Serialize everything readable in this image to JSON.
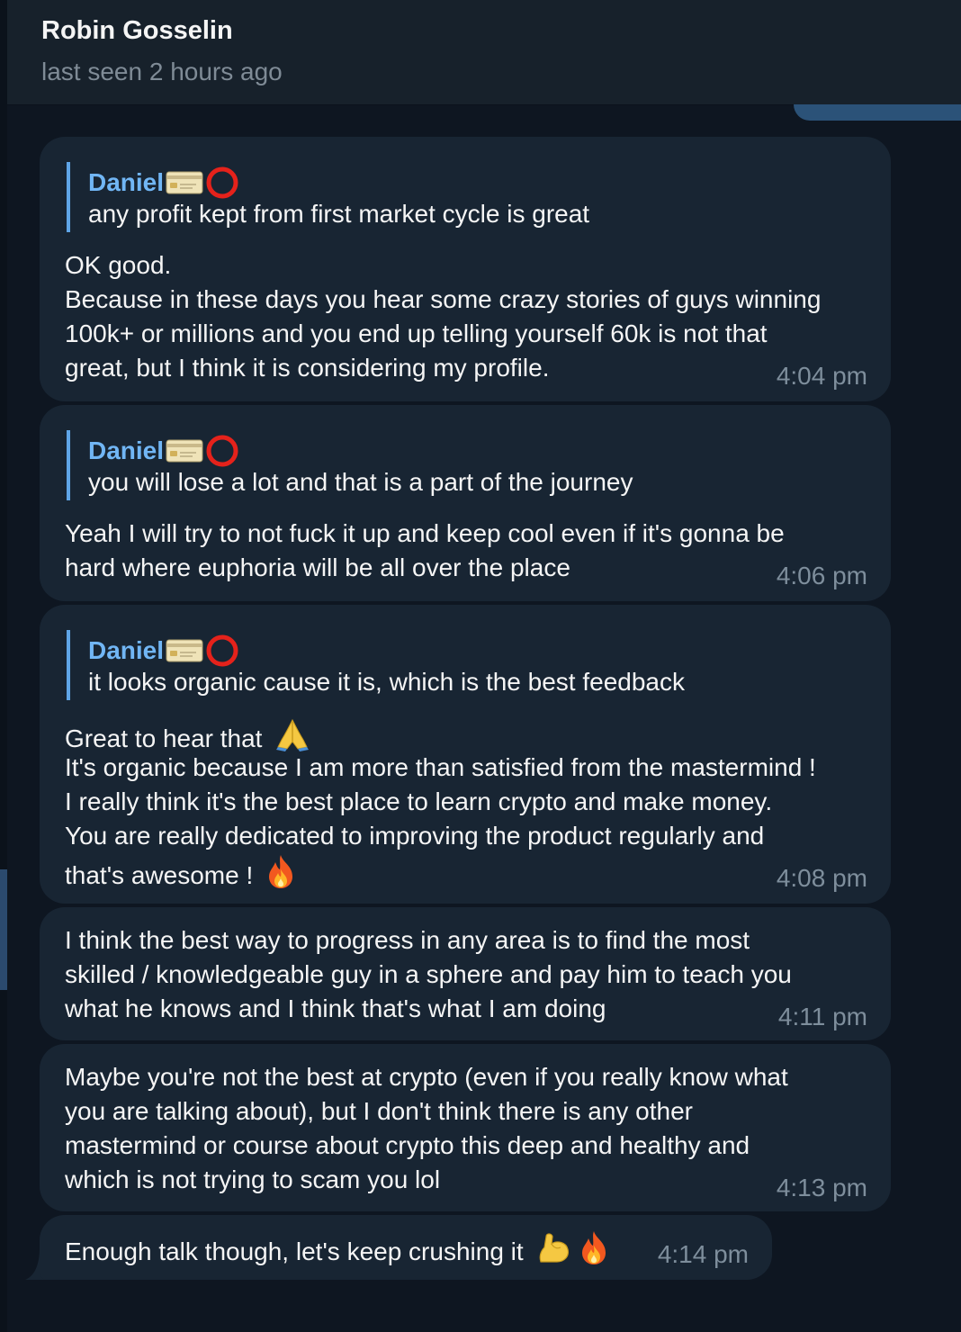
{
  "header": {
    "contact_name": "Robin Gosselin",
    "status": "last seen 2 hours ago"
  },
  "messages": [
    {
      "reply_author": "Daniel",
      "reply_text": "any profit kept from first market cycle is great",
      "lines": [
        "OK good.",
        "Because in these days you hear some crazy stories of guys winning",
        "100k+ or millions and you end up telling yourself 60k is not that",
        "great, but I think it is considering my profile."
      ],
      "time": "4:04 pm"
    },
    {
      "reply_author": "Daniel",
      "reply_text": "you will lose a lot and that is a part of the journey",
      "lines": [
        "Yeah I will try to not fuck it up and keep cool even if it's gonna be",
        "hard where euphoria will be all over the place"
      ],
      "time": "4:06 pm"
    },
    {
      "reply_author": "Daniel",
      "reply_text": "it looks organic cause it is, which is the best feedback",
      "lines": [
        "Great to hear that",
        "It's organic because I am more than satisfied from the mastermind !",
        "I really think it's the best place to learn crypto and make money.",
        "You are really dedicated to improving the product regularly and",
        "that's awesome !"
      ],
      "time": "4:08 pm"
    },
    {
      "lines": [
        "I think the best way to progress in any area is to find the most",
        "skilled / knowledgeable guy in a sphere and pay him to teach you",
        "what he knows and I think that's what I am doing"
      ],
      "time": "4:11 pm"
    },
    {
      "lines": [
        "Maybe you're not the best at crypto (even if you really know what",
        "you are talking about), but I don't think there is any other",
        "mastermind or course about crypto this deep and healthy and",
        "which is not trying to scam you lol"
      ],
      "time": "4:13 pm"
    },
    {
      "lines": [
        "Enough talk though, let's keep crushing it"
      ],
      "time": "4:14 pm"
    }
  ],
  "colors": {
    "background": "#0e1621",
    "bubble": "#182533",
    "header": "#17212b",
    "reply_accent": "#5fa5e7",
    "reply_name": "#71b6f5",
    "timestamp": "#7e8e9c"
  },
  "icons": [
    "credit-card-emoji",
    "hollow-red-circle-emoji",
    "folded-hands-emoji",
    "fire-emoji",
    "flexed-biceps-emoji"
  ]
}
